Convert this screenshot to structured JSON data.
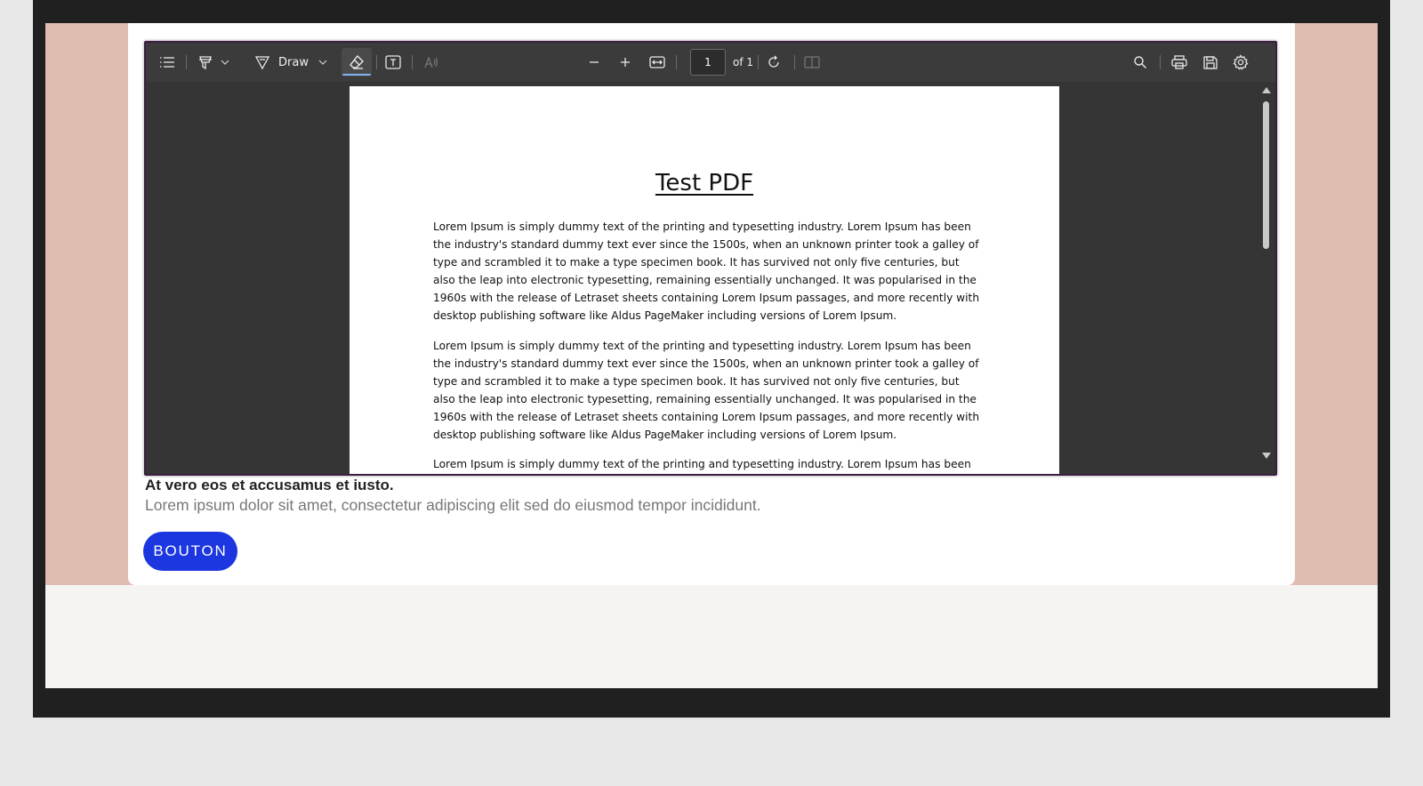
{
  "toolbar": {
    "draw_label": "Draw",
    "page_number": "1",
    "page_total": "of 1",
    "icons": [
      "contents-icon",
      "highlight-icon",
      "dropdown-icon",
      "draw-icon",
      "eraser-icon",
      "text-box-icon",
      "read-aloud-icon",
      "zoom-out-icon",
      "zoom-in-icon",
      "fit-width-icon",
      "rotate-icon",
      "page-view-icon",
      "search-icon",
      "print-icon",
      "save-icon",
      "settings-icon"
    ]
  },
  "document": {
    "title": "Test PDF",
    "paragraphs": [
      "Lorem Ipsum is simply dummy text of the printing and typesetting industry. Lorem Ipsum has been the industry's standard dummy text ever since the 1500s, when an unknown printer took a galley of type and scrambled it to make a type specimen book. It has survived not only five centuries, but also the leap into electronic typesetting, remaining essentially unchanged. It was popularised in the 1960s with the release of Letraset sheets containing Lorem Ipsum passages, and more recently with desktop publishing software like Aldus PageMaker including versions of Lorem Ipsum.",
      "Lorem Ipsum is simply dummy text of the printing and typesetting industry. Lorem Ipsum has been the industry's standard dummy text ever since the 1500s, when an unknown printer took a galley of type and scrambled it to make a type specimen book. It has survived not only five centuries, but also the leap into electronic typesetting, remaining essentially unchanged. It was popularised in the 1960s with the release of Letraset sheets containing Lorem Ipsum passages, and more recently with desktop publishing software like Aldus PageMaker including versions of Lorem Ipsum.",
      "Lorem Ipsum is simply dummy text of the printing and typesetting industry. Lorem Ipsum has been the"
    ]
  },
  "card": {
    "headline": "At vero eos et accusamus et iusto.",
    "subline": "Lorem ipsum dolor sit amet, consectetur adipiscing elit sed do eiusmod tempor incididunt.",
    "button_label": "BOUTON"
  },
  "colors": {
    "accent": "#1c36e0",
    "band": "#dfbdb0",
    "viewer_bg": "#353535",
    "toolbar_bg": "#3b3b3b"
  }
}
